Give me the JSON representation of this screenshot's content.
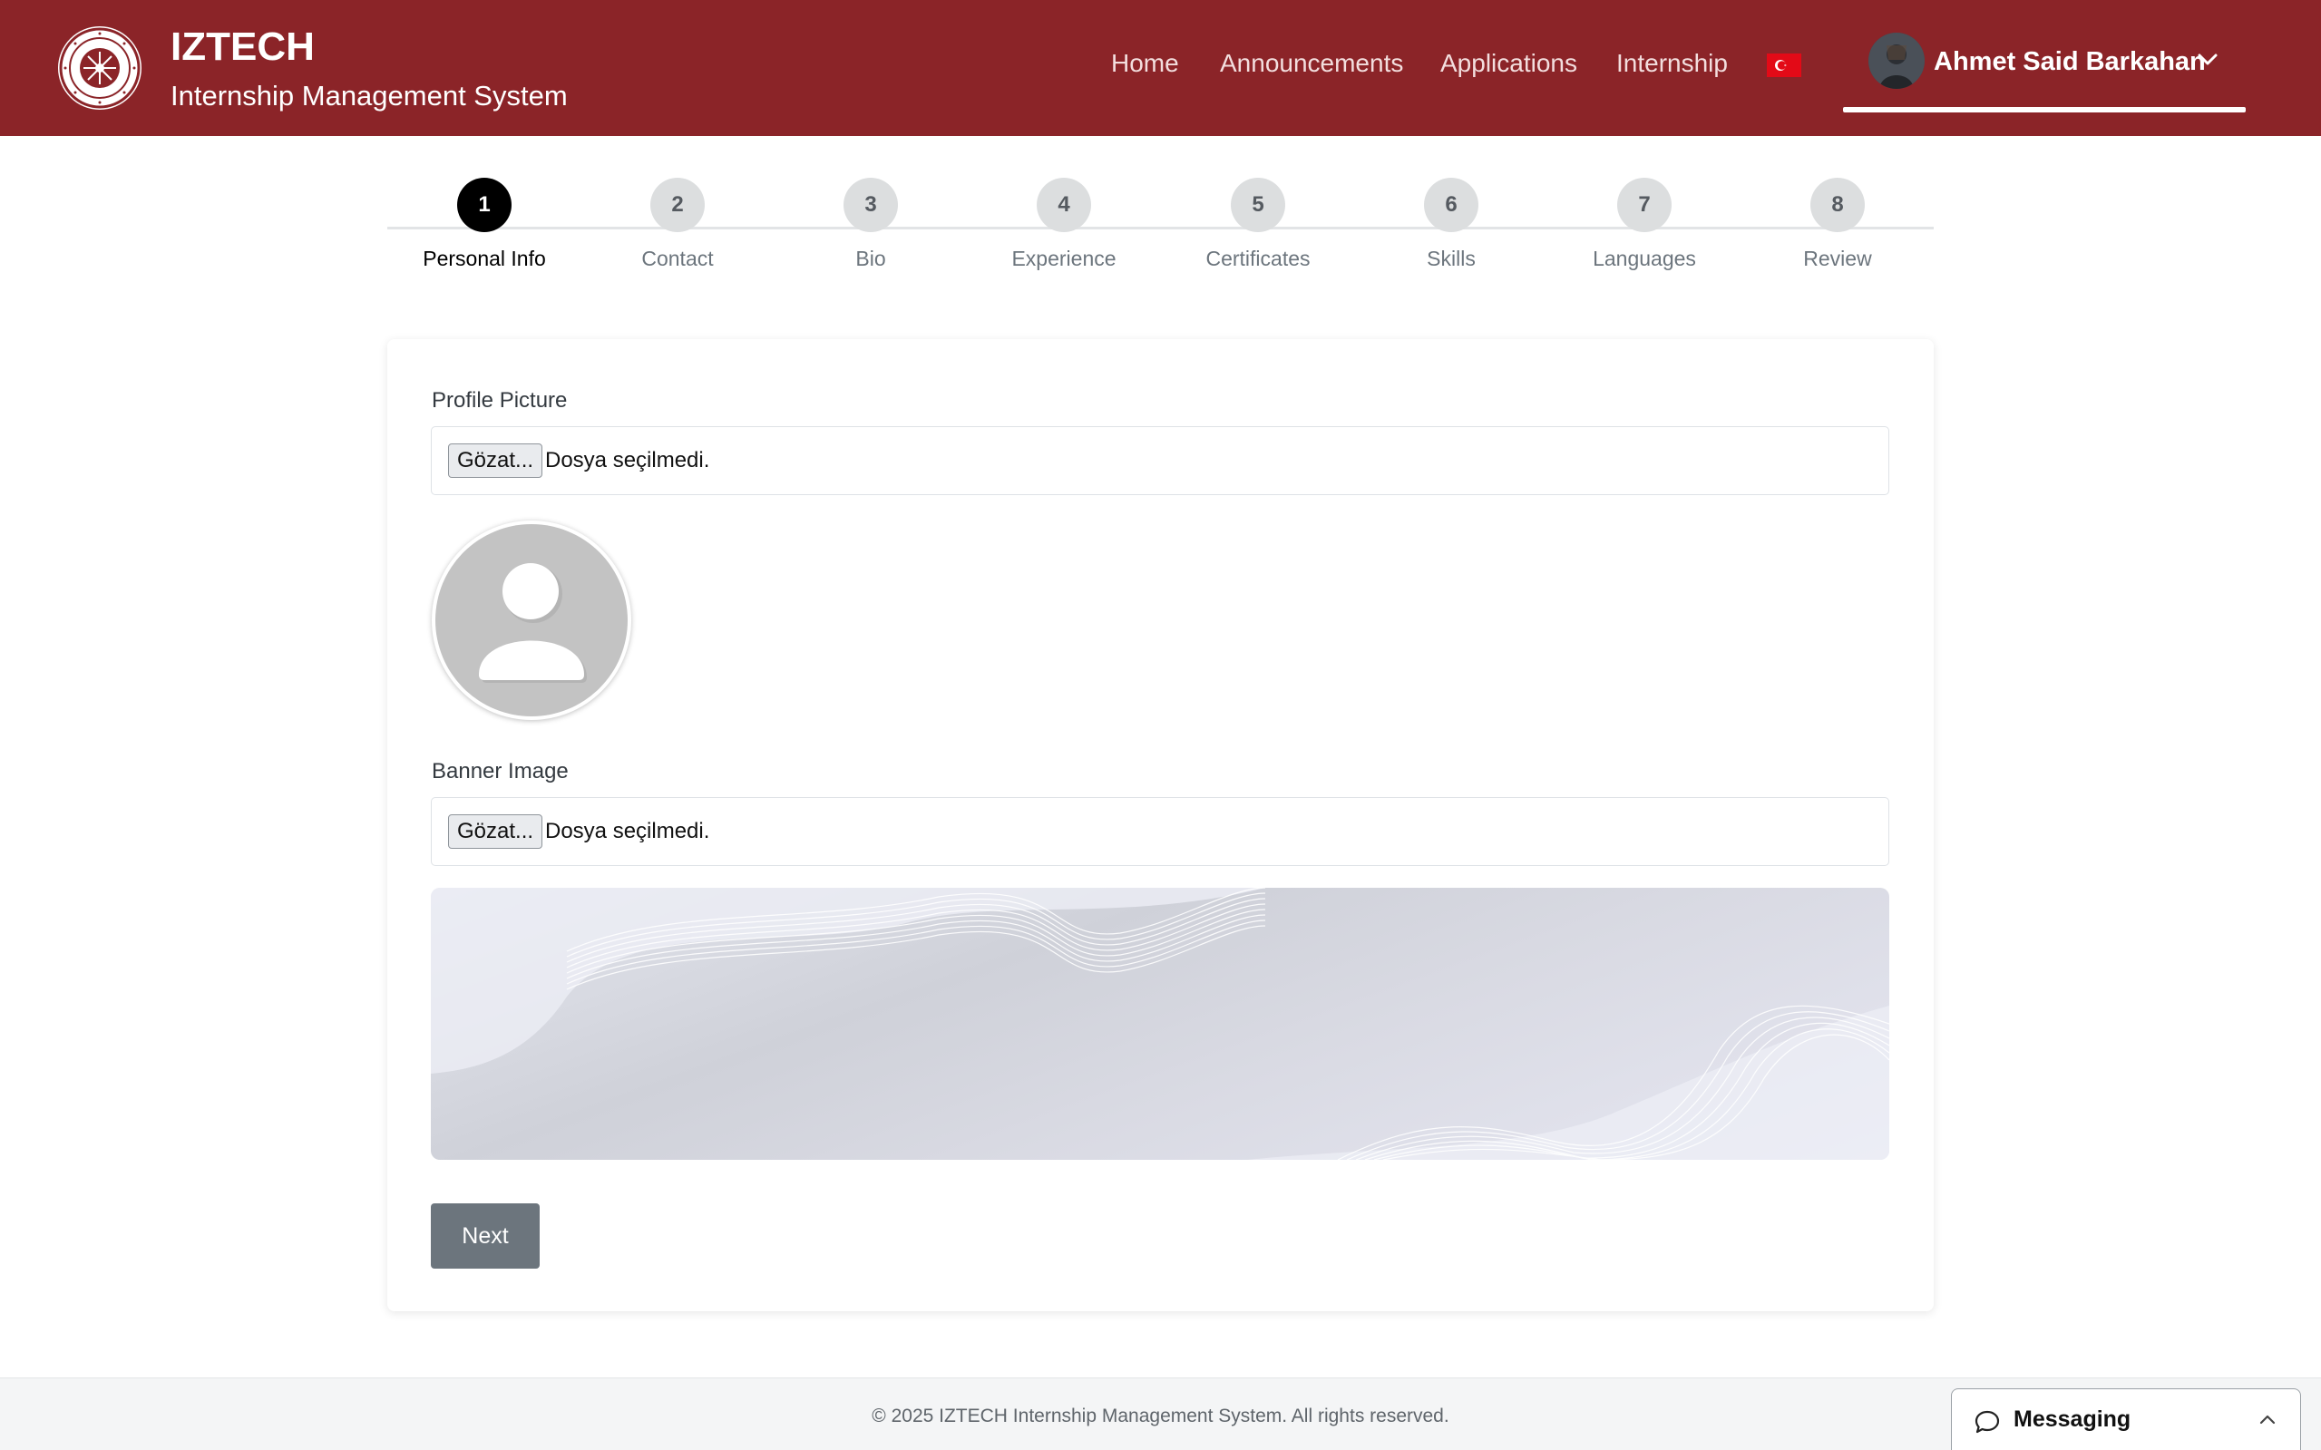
{
  "header": {
    "brand_title": "IZTECH",
    "brand_subtitle": "Internship Management System",
    "logo_icon": "university-seal-icon",
    "background_color": "#8b2428",
    "nav": [
      {
        "label": "Home"
      },
      {
        "label": "Announcements"
      },
      {
        "label": "Applications"
      },
      {
        "label": "Internship"
      }
    ],
    "language_flag_icon": "turkey-flag-icon",
    "user": {
      "name": "Ahmet Said Barkahan",
      "avatar_icon": "user-avatar-photo"
    }
  },
  "stepper": {
    "active_step": 1,
    "steps": [
      {
        "number": "1",
        "label": "Personal Info"
      },
      {
        "number": "2",
        "label": "Contact"
      },
      {
        "number": "3",
        "label": "Bio"
      },
      {
        "number": "4",
        "label": "Experience"
      },
      {
        "number": "5",
        "label": "Certificates"
      },
      {
        "number": "6",
        "label": "Skills"
      },
      {
        "number": "7",
        "label": "Languages"
      },
      {
        "number": "8",
        "label": "Review"
      }
    ]
  },
  "form": {
    "profile_picture": {
      "label": "Profile Picture",
      "browse_label": "Gözat...",
      "status": "Dosya seçilmedi."
    },
    "banner_image": {
      "label": "Banner Image",
      "browse_label": "Gözat...",
      "status": "Dosya seçilmedi."
    },
    "next_label": "Next"
  },
  "footer": {
    "copyright": "© 2025 IZTECH Internship Management System. All rights reserved."
  },
  "messaging": {
    "label": "Messaging"
  }
}
